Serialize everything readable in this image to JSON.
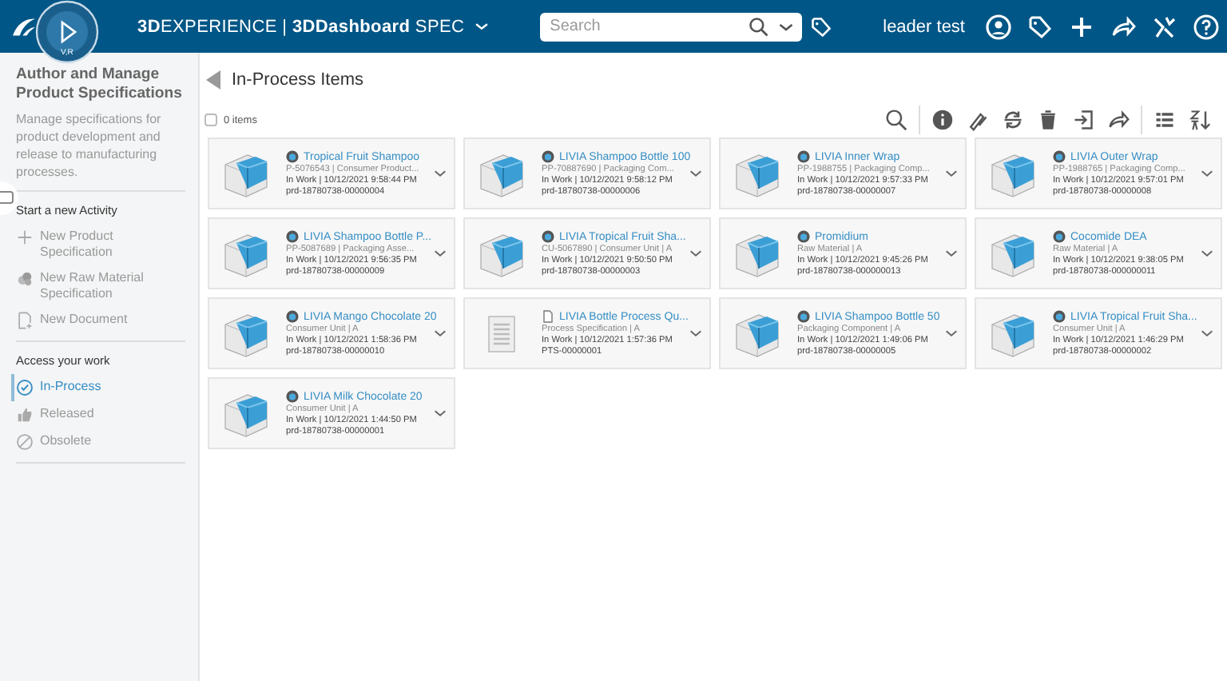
{
  "topbar": {
    "brand_bold": "3D",
    "brand_rest": "EXPERIENCE | ",
    "app_bold": "3DDashboard",
    "app_rest": "SPEC",
    "compass_label": "V,R",
    "search": {
      "placeholder": "Search"
    },
    "user": "leader test"
  },
  "sidebar": {
    "title": "Author and Manage Product Specifications",
    "description": "Manage specifications for product development and release to manufacturing processes.",
    "sections": [
      {
        "heading": "Start a new Activity",
        "items": [
          {
            "label": "New Product Specification",
            "kind": "plus",
            "selected": false
          },
          {
            "label": "New Raw Material Specification",
            "kind": "material",
            "selected": false
          },
          {
            "label": "New Document",
            "kind": "document",
            "selected": false
          }
        ]
      },
      {
        "heading": "Access your work",
        "items": [
          {
            "label": "In-Process",
            "kind": "check",
            "selected": true
          },
          {
            "label": "Released",
            "kind": "thumb",
            "selected": false
          },
          {
            "label": "Obsolete",
            "kind": "ban",
            "selected": false
          }
        ]
      }
    ]
  },
  "main": {
    "title": "In-Process Items",
    "count": "0 items",
    "select_all": {
      "checked": false
    },
    "cards": [
      {
        "kind": "part",
        "title": "Tropical Fruit Shampoo",
        "subtitle": "P-5076543 | Consumer Product...",
        "status": "In Work | 10/12/2021 9:58:44 PM",
        "id": "prd-18780738-00000004"
      },
      {
        "kind": "part",
        "title": "LIVIA Shampoo Bottle 100",
        "subtitle": "PP-70887690 | Packaging Com...",
        "status": "In Work | 10/12/2021 9:58:12 PM",
        "id": "prd-18780738-00000006"
      },
      {
        "kind": "part",
        "title": "LIVIA Inner Wrap",
        "subtitle": "PP-1988755 | Packaging Comp...",
        "status": "In Work | 10/12/2021 9:57:33 PM",
        "id": "prd-18780738-00000007"
      },
      {
        "kind": "part",
        "title": "LIVIA Outer Wrap",
        "subtitle": "PP-1988765 | Packaging Comp...",
        "status": "In Work | 10/12/2021 9:57:01 PM",
        "id": "prd-18780738-00000008"
      },
      {
        "kind": "part",
        "title": "LIVIA Shampoo Bottle P...",
        "subtitle": "PP-5087689 | Packaging Asse...",
        "status": "In Work | 10/12/2021 9:56:35 PM",
        "id": "prd-18780738-00000009"
      },
      {
        "kind": "part",
        "title": "LIVIA Tropical Fruit Sha...",
        "subtitle": "CU-5067890 | Consumer Unit | A",
        "status": "In Work | 10/12/2021 9:50:50 PM",
        "id": "prd-18780738-00000003"
      },
      {
        "kind": "part",
        "title": "Promidium",
        "subtitle": "Raw Material | A",
        "status": "In Work | 10/12/2021 9:45:26 PM",
        "id": "prd-18780738-000000013"
      },
      {
        "kind": "part",
        "title": "Cocomide DEA",
        "subtitle": "Raw Material | A",
        "status": "In Work | 10/12/2021 9:38:05 PM",
        "id": "prd-18780738-000000011"
      },
      {
        "kind": "part",
        "title": "LIVIA Mango Chocolate 20",
        "subtitle": "Consumer Unit | A",
        "status": "In Work | 10/12/2021 1:58:36 PM",
        "id": "prd-18780738-00000010"
      },
      {
        "kind": "document",
        "title": "LIVIA Bottle Process Qu...",
        "subtitle": "Process Specification | A",
        "status": "In Work | 10/12/2021 1:57:36 PM",
        "id": "PTS-00000001"
      },
      {
        "kind": "part",
        "title": "LIVIA Shampoo Bottle 50",
        "subtitle": "Packaging Component | A",
        "status": "In Work | 10/12/2021 1:49:06 PM",
        "id": "prd-18780738-00000005"
      },
      {
        "kind": "part",
        "title": "LIVIA Tropical Fruit Sha...",
        "subtitle": "Consumer Unit | A",
        "status": "In Work | 10/12/2021 1:46:29 PM",
        "id": "prd-18780738-00000002"
      },
      {
        "kind": "part",
        "title": "LIVIA Milk Chocolate 20",
        "subtitle": "Consumer Unit | A",
        "status": "In Work | 10/12/2021 1:44:50 PM",
        "id": "prd-18780738-00000001"
      }
    ]
  }
}
